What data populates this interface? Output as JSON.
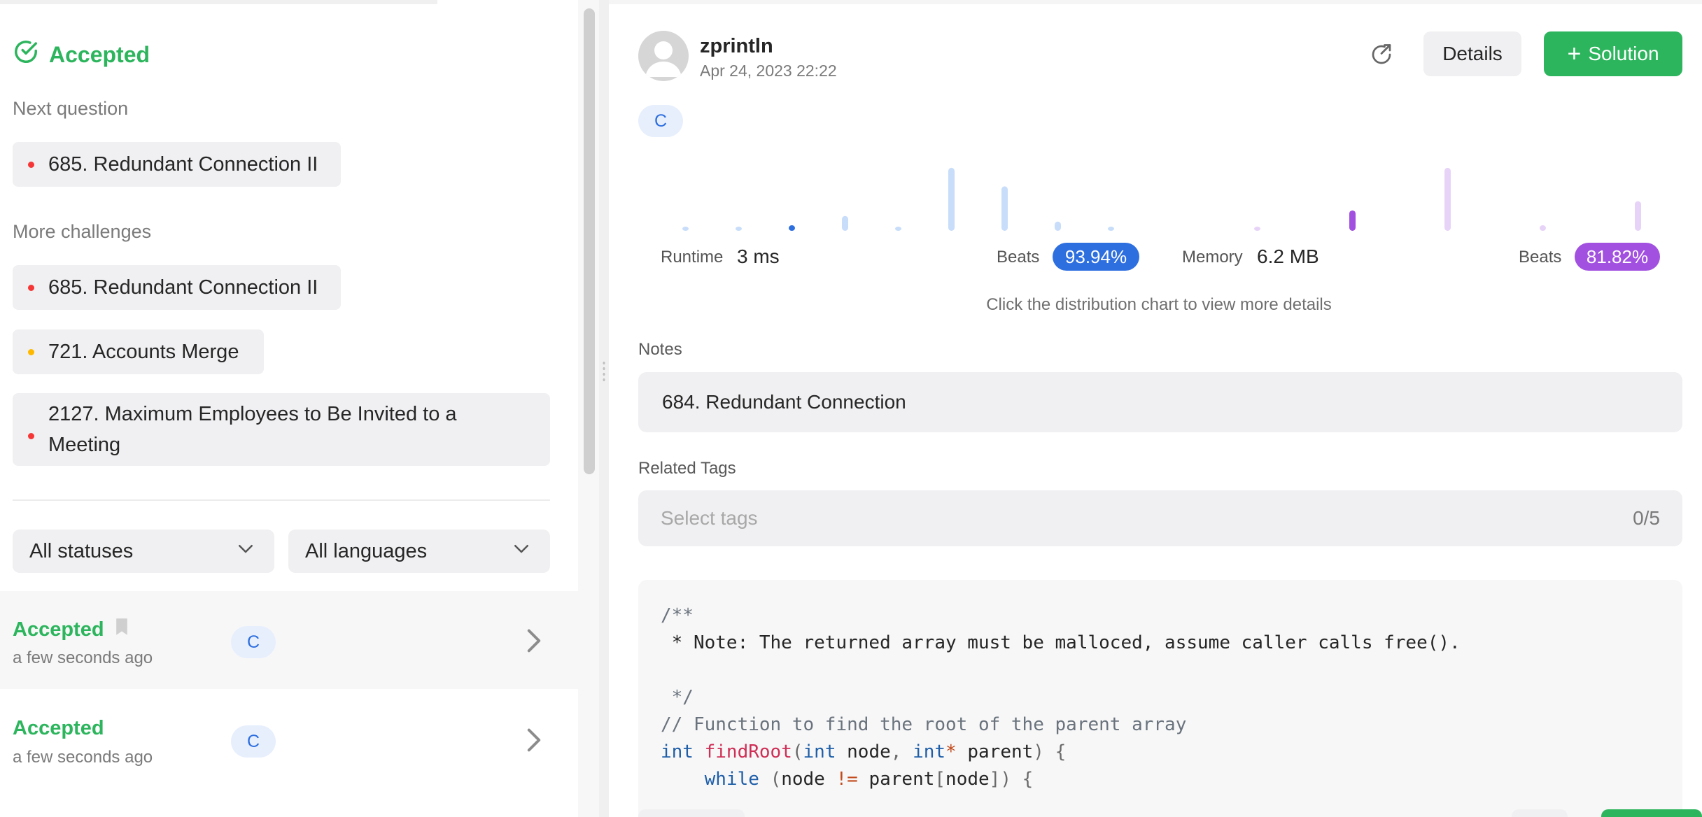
{
  "left": {
    "status": "Accepted",
    "next_question_label": "Next question",
    "next_question": {
      "title": "685. Redundant Connection II",
      "difficulty": "hard"
    },
    "more_challenges_label": "More challenges",
    "more_challenges": [
      {
        "title": "685. Redundant Connection II",
        "difficulty": "hard"
      },
      {
        "title": "721. Accounts Merge",
        "difficulty": "medium"
      },
      {
        "title": "2127. Maximum Employees to Be Invited to a Meeting",
        "difficulty": "hard"
      }
    ],
    "filters": {
      "status": "All statuses",
      "language": "All languages"
    },
    "submissions": [
      {
        "status": "Accepted",
        "time": "a few seconds ago",
        "lang": "C",
        "bookmark": true
      },
      {
        "status": "Accepted",
        "time": "a few seconds ago",
        "lang": "C",
        "bookmark": false
      }
    ]
  },
  "right": {
    "user": {
      "name": "zprintln",
      "date": "Apr 24, 2023 22:22"
    },
    "buttons": {
      "details": "Details",
      "solution": "Solution"
    },
    "lang": "C",
    "runtime": {
      "label": "Runtime",
      "value": "3 ms",
      "beats_label": "Beats",
      "beats": "93.94%"
    },
    "memory": {
      "label": "Memory",
      "value": "6.2 MB",
      "beats_label": "Beats",
      "beats": "81.82%"
    },
    "hint": "Click the distribution chart to view more details",
    "notes_label": "Notes",
    "notes": "684. Redundant Connection",
    "tags_label": "Related Tags",
    "tags_placeholder": "Select tags",
    "tags_count": "0/5",
    "colors": {
      "accepted": "#2db55d",
      "runtime": "#2e6fe0",
      "memory": "#a150e0"
    }
  },
  "distribution": {
    "runtime_bars": [
      1,
      1,
      1.5,
      4,
      1,
      17,
      12,
      2.5,
      1
    ],
    "runtime_active_index": 2,
    "memory_bars": [
      1,
      5.5,
      17,
      1.5,
      8
    ],
    "memory_active_index": 1
  }
}
